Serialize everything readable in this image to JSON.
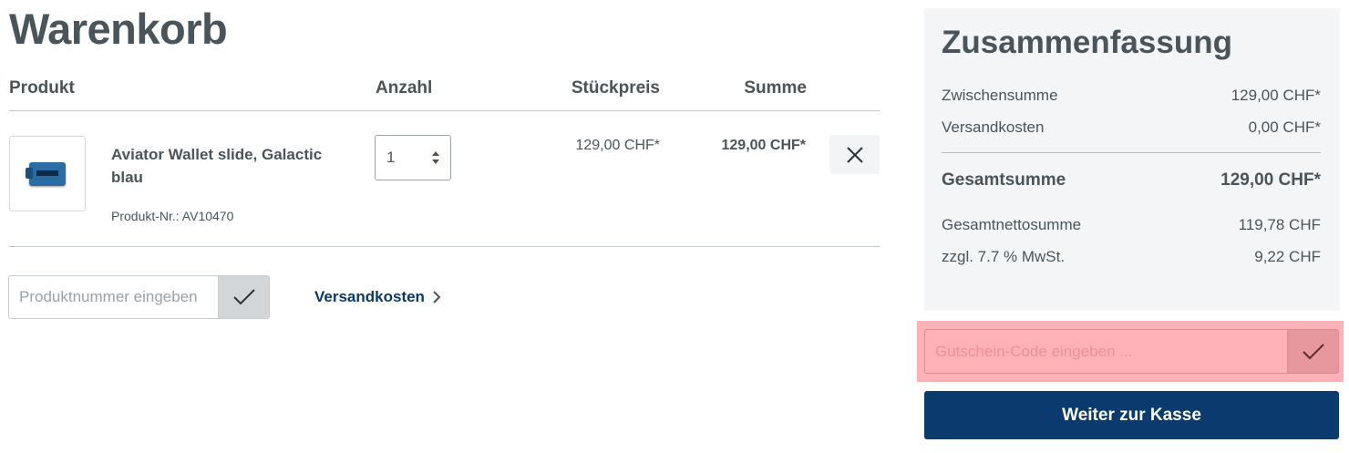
{
  "page": {
    "title": "Warenkorb"
  },
  "cart": {
    "headers": {
      "product": "Produkt",
      "quantity": "Anzahl",
      "unit_price": "Stückpreis",
      "total": "Summe"
    },
    "items": [
      {
        "name": "Aviator Wallet slide, Galactic blau",
        "product_number": "Produkt-Nr.: AV10470",
        "quantity": "1",
        "unit_price": "129,00 CHF*",
        "total": "129,00 CHF*",
        "image_icon": "wallet-image"
      }
    ],
    "product_input_placeholder": "Produktnummer eingeben",
    "shipping_link": "Versandkosten"
  },
  "summary": {
    "title": "Zusammenfassung",
    "subtotal_label": "Zwischensumme",
    "subtotal_value": "129,00 CHF*",
    "shipping_label": "Versandkosten",
    "shipping_value": "0,00 CHF*",
    "grand_total_label": "Gesamtsumme",
    "grand_total_value": "129,00 CHF*",
    "net_total_label": "Gesamtnettosumme",
    "net_total_value": "119,78 CHF",
    "tax_label": "zzgl. 7.7 % MwSt.",
    "tax_value": "9,22 CHF"
  },
  "voucher": {
    "placeholder": "Gutschein-Code eingeben ..."
  },
  "checkout": {
    "label": "Weiter zur Kasse"
  },
  "colors": {
    "primary": "#0b3a6e",
    "text": "#4a545b",
    "highlight": "#ffb3b8"
  }
}
